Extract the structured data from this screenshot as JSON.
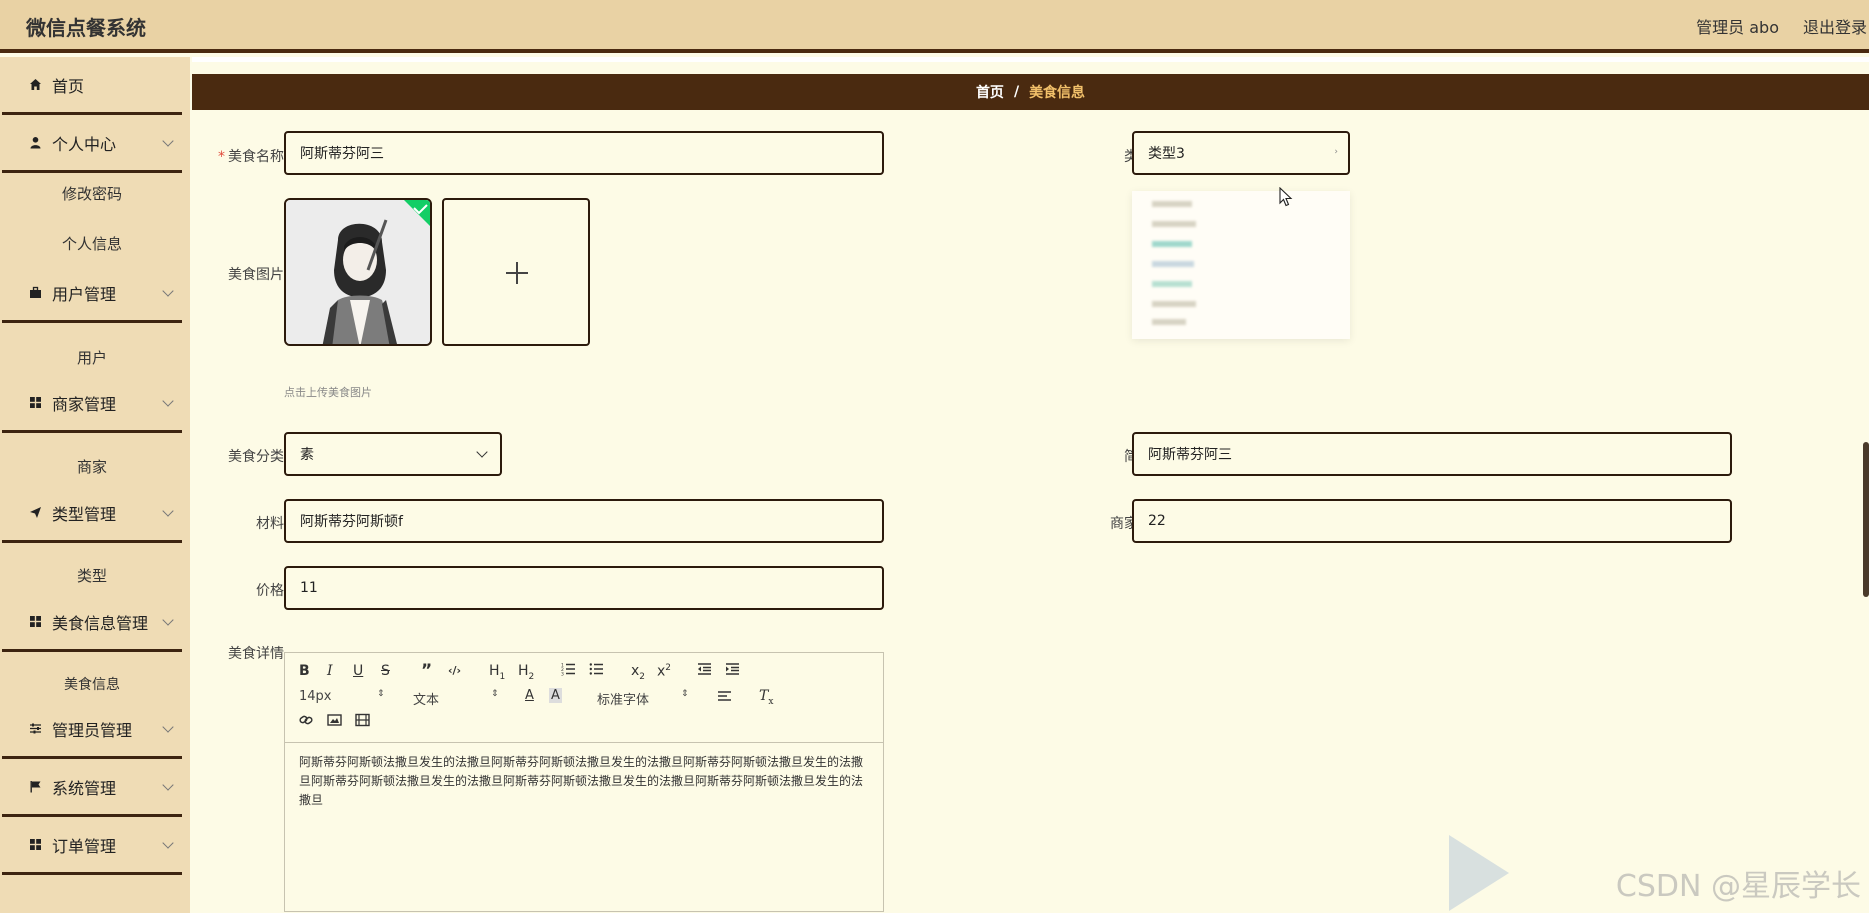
{
  "header": {
    "title": "微信点餐系统",
    "admin": "管理员 abo",
    "logout": "退出登录"
  },
  "sidebar": {
    "items": [
      {
        "label": "首页",
        "icon": "home-icon"
      },
      {
        "label": "个人中心",
        "icon": "user-icon"
      },
      {
        "label": "修改密码"
      },
      {
        "label": "个人信息"
      },
      {
        "label": "用户管理",
        "icon": "briefcase-icon"
      },
      {
        "label": "用户"
      },
      {
        "label": "商家管理",
        "icon": "grid-icon"
      },
      {
        "label": "商家"
      },
      {
        "label": "类型管理",
        "icon": "send-icon"
      },
      {
        "label": "类型"
      },
      {
        "label": "美食信息管理",
        "icon": "grid-icon"
      },
      {
        "label": "美食信息"
      },
      {
        "label": "管理员管理",
        "icon": "sliders-icon"
      },
      {
        "label": "系统管理",
        "icon": "flag-icon"
      },
      {
        "label": "订单管理",
        "icon": "grid-icon"
      }
    ]
  },
  "breadcrumb": {
    "home": "首页",
    "sep": "/",
    "current": "美食信息"
  },
  "form": {
    "name_label": "美食名称",
    "name_value": "阿斯蒂芬阿三",
    "type_label": "类型",
    "type_value": "类型3",
    "image_label": "美食图片",
    "image_hint": "点击上传美食图片",
    "category_label": "美食分类",
    "category_value": "素",
    "intro_label": "简介",
    "intro_value": "阿斯蒂芬阿三",
    "material_label": "材料",
    "material_value": "阿斯蒂芬阿斯顿f",
    "merchant_label": "商家号",
    "merchant_value": "22",
    "price_label": "价格",
    "price_value": "11",
    "detail_label": "美食详情"
  },
  "editor": {
    "font_size": "14px",
    "block_format": "文本",
    "font_family": "标准字体",
    "content": "阿斯蒂芬阿斯顿法撒旦发生的法撒旦阿斯蒂芬阿斯顿法撒旦发生的法撒旦阿斯蒂芬阿斯顿法撒旦发生的法撒旦阿斯蒂芬阿斯顿法撒旦发生的法撒旦阿斯蒂芬阿斯顿法撒旦发生的法撒旦阿斯蒂芬阿斯顿法撒旦发生的法撒旦"
  },
  "watermark": "CSDN @星辰学长"
}
